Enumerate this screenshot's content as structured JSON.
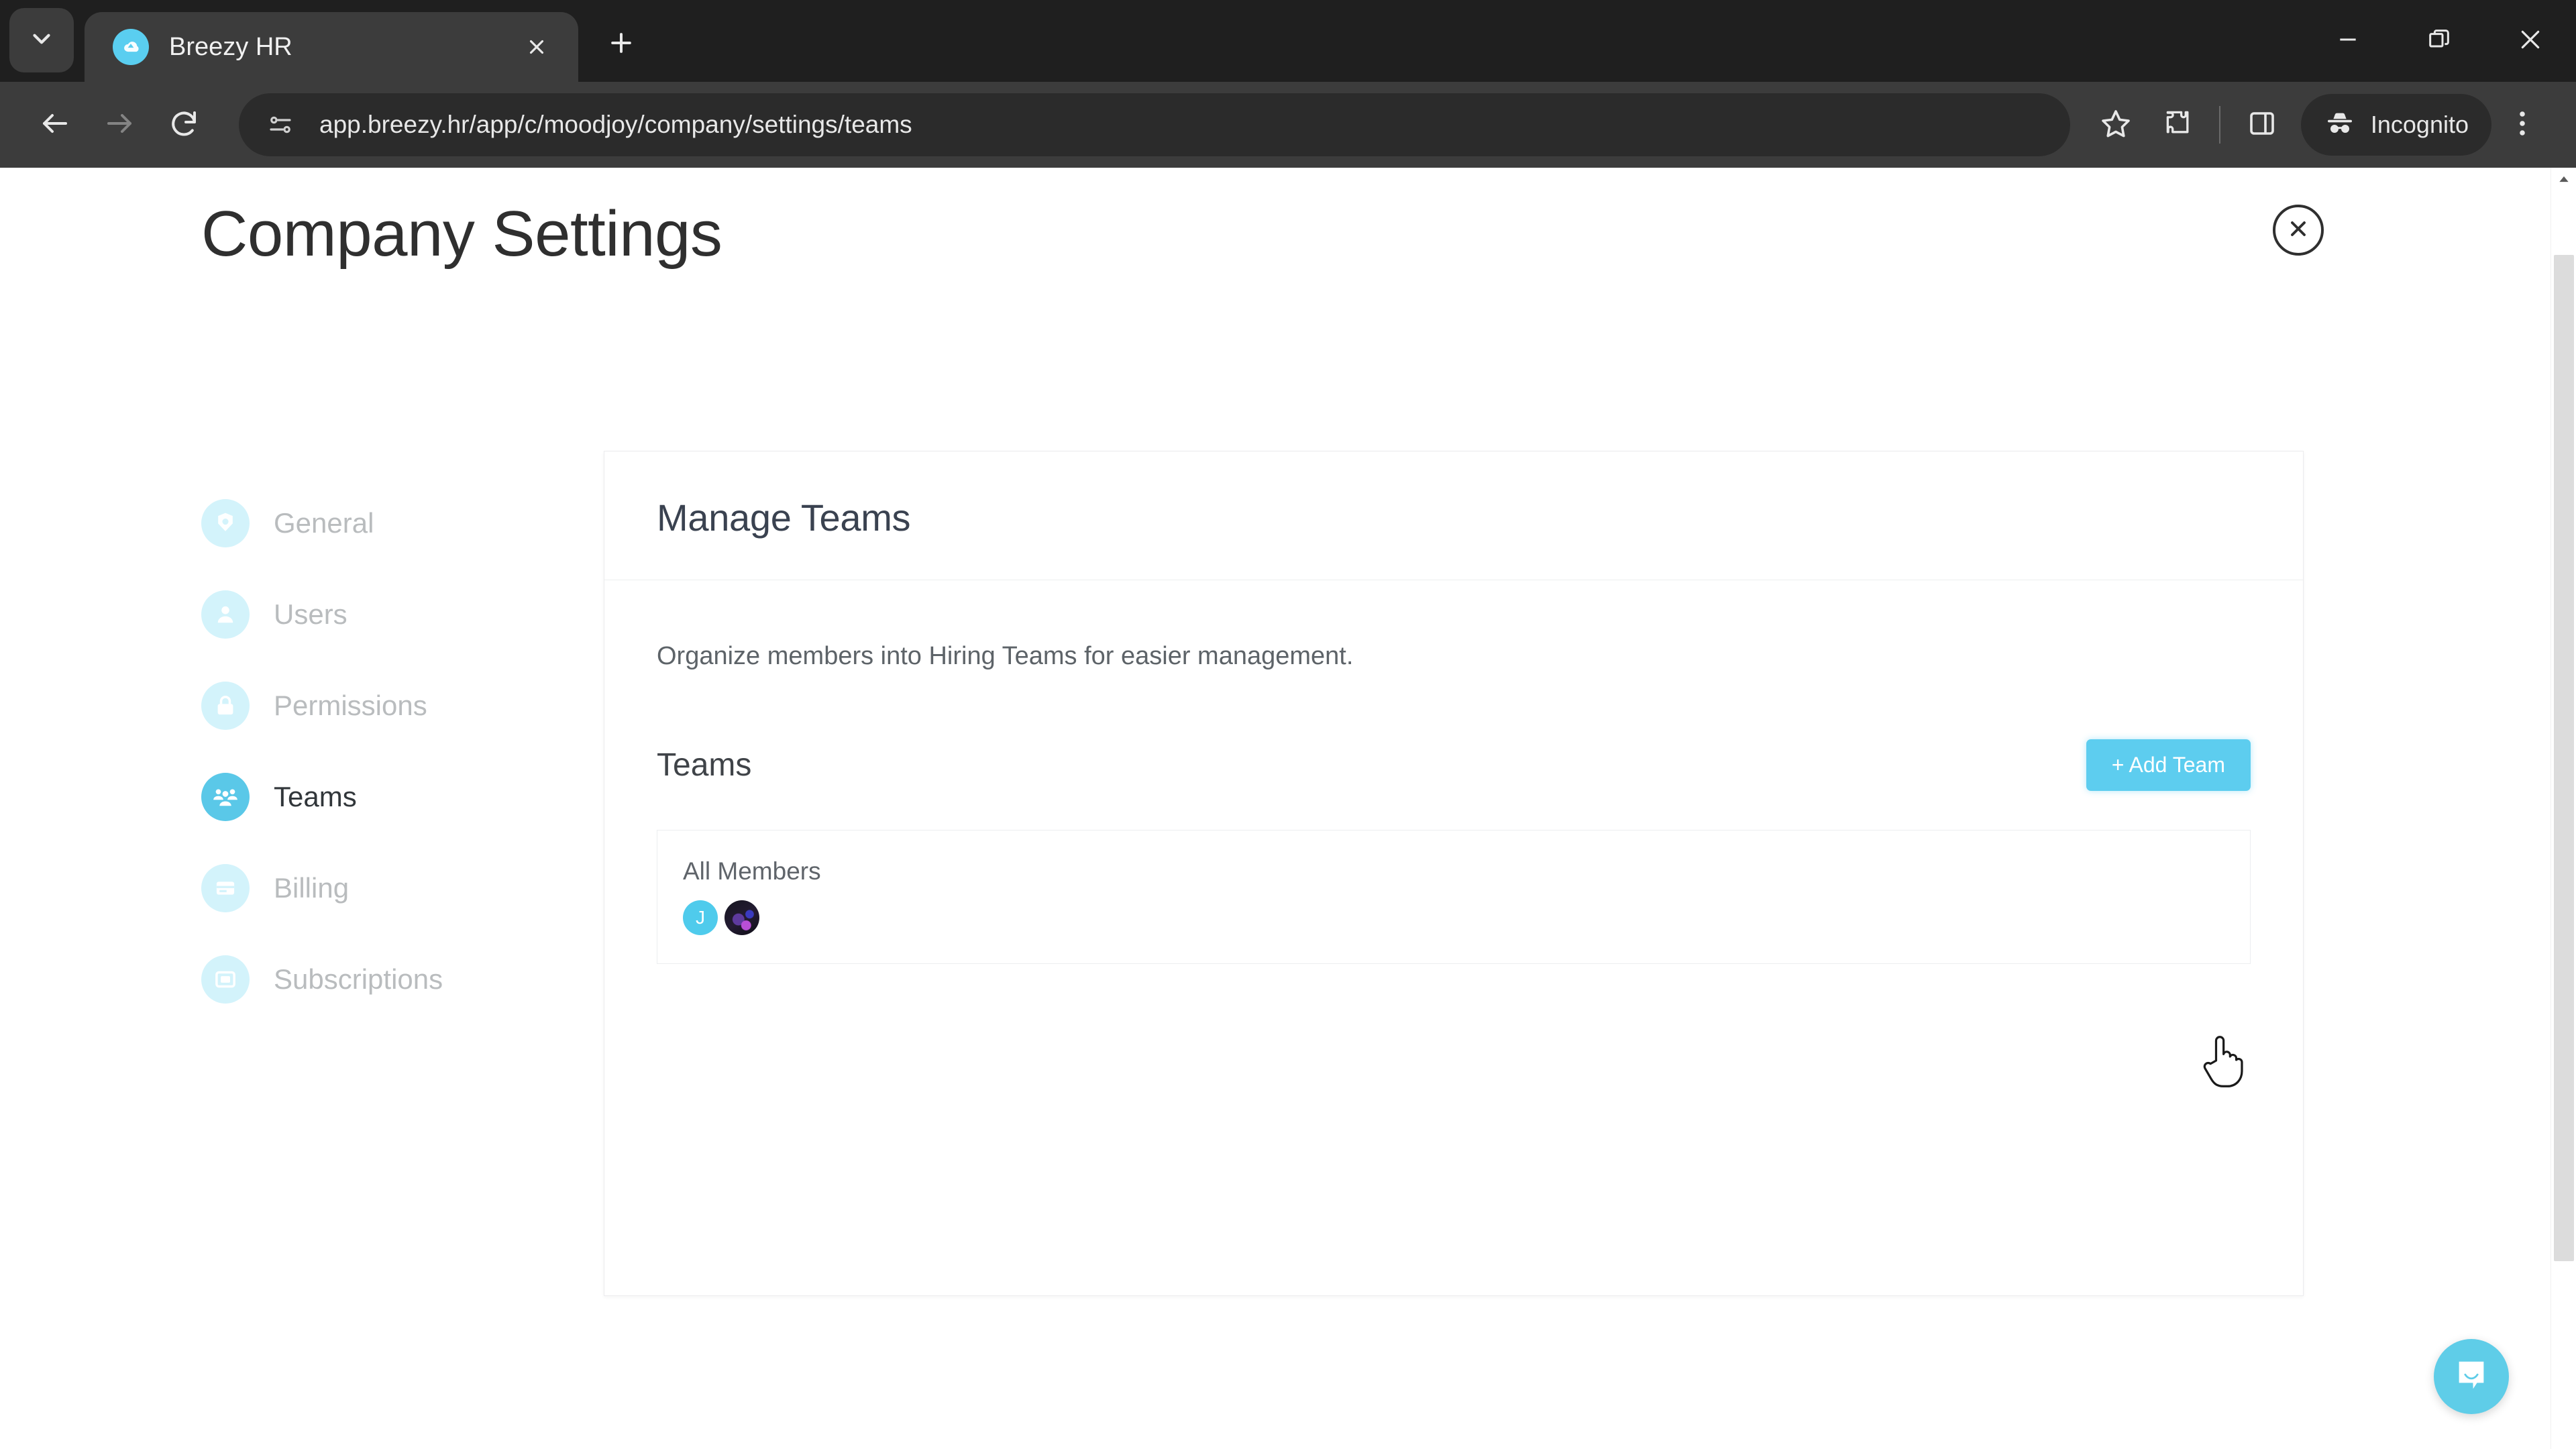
{
  "browser": {
    "tab": {
      "title": "Breezy HR",
      "favicon_icon": "cloud-icon",
      "close_icon": "close-icon"
    },
    "tablist_icon": "chevron-down-icon",
    "new_tab_icon": "plus-icon",
    "window_controls": {
      "minimize_icon": "minimize-icon",
      "maximize_icon": "restore-icon",
      "close_icon": "close-icon"
    },
    "toolbar": {
      "back_icon": "arrow-left-icon",
      "forward_icon": "arrow-right-icon",
      "reload_icon": "reload-icon",
      "site_info_icon": "page-settings-icon",
      "url": "app.breezy.hr/app/c/moodjoy/company/settings/teams",
      "url_placeholder": "Search Google or type a URL",
      "bookmark_icon": "star-icon",
      "extensions_icon": "puzzle-icon",
      "side_panel_icon": "side-panel-icon",
      "profile_label": "Incognito",
      "profile_icon": "incognito-icon",
      "menu_icon": "kebab-menu-icon"
    }
  },
  "page": {
    "title": "Company Settings",
    "close_icon": "close-icon",
    "sidebar": {
      "items": [
        {
          "label": "General",
          "icon": "gear-icon",
          "active": false
        },
        {
          "label": "Users",
          "icon": "user-icon",
          "active": false
        },
        {
          "label": "Permissions",
          "icon": "lock-icon",
          "active": false
        },
        {
          "label": "Teams",
          "icon": "group-icon",
          "active": true
        },
        {
          "label": "Billing",
          "icon": "card-icon",
          "active": false
        },
        {
          "label": "Subscriptions",
          "icon": "monitor-icon",
          "active": false
        }
      ]
    },
    "card": {
      "heading": "Manage Teams",
      "description": "Organize members into Hiring Teams for easier management.",
      "teams_section_label": "Teams",
      "add_team_label": "+ Add Team",
      "teams": [
        {
          "name": "All Members",
          "members": [
            {
              "type": "initial",
              "initial": "J"
            },
            {
              "type": "photo",
              "initial": ""
            }
          ]
        }
      ]
    },
    "intercom_icon": "chat-bubble-icon",
    "scrollbar": {
      "up_arrow_icon": "caret-up-icon"
    }
  },
  "colors": {
    "accent": "#5DCDEF",
    "accent_soft": "#d3f3fb",
    "chrome_dark": "#3c3c3c",
    "tabstrip_dark": "#1f1f1f",
    "heading": "#3a4250"
  }
}
